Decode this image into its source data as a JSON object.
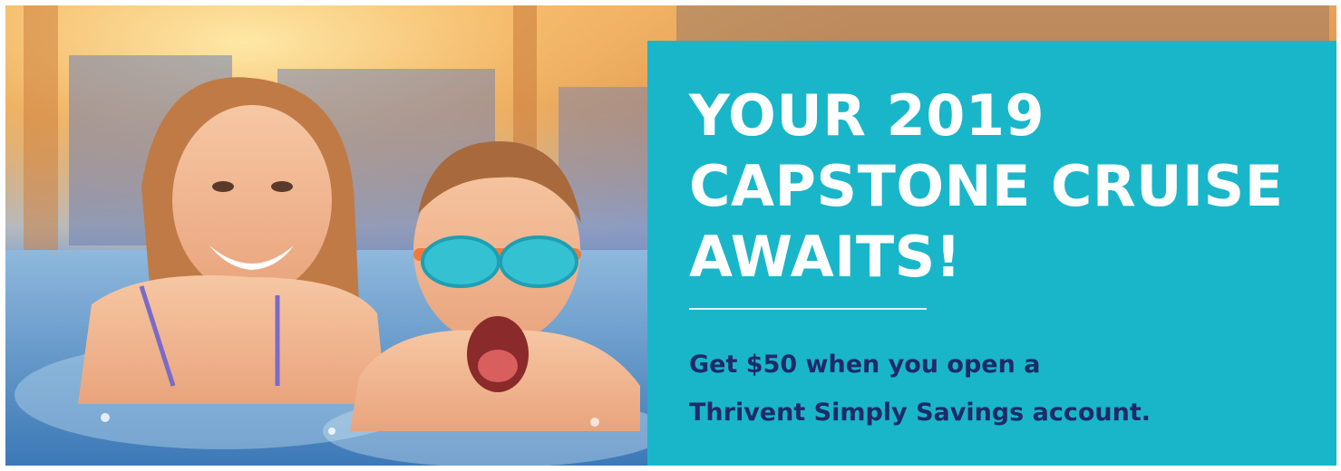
{
  "promo": {
    "headline_lines": [
      "YOUR 2019",
      "CAPSTONE CRUISE",
      "AWAITS!"
    ],
    "offer_lines": [
      "Get $50 when you open a",
      "Thrivent Simply Savings account."
    ]
  },
  "image": {
    "subject": "kids-in-pool-photo"
  },
  "colors": {
    "panel_background": "#19b6c9",
    "headline_text": "#ffffff",
    "offer_text": "#1d2a6b",
    "divider": "#ffffff"
  }
}
